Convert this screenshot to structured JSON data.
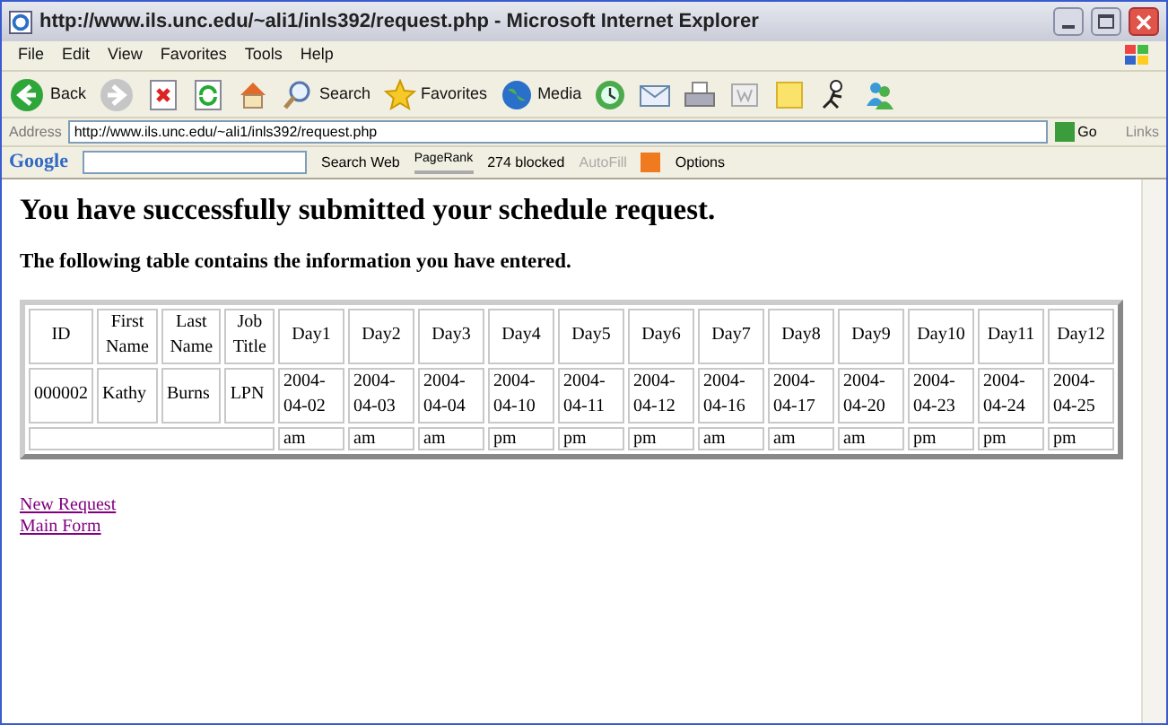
{
  "window": {
    "title": "http://www.ils.unc.edu/~ali1/inls392/request.php - Microsoft Internet Explorer"
  },
  "menu": [
    "File",
    "Edit",
    "View",
    "Favorites",
    "Tools",
    "Help"
  ],
  "toolbar": [
    {
      "kind": "back",
      "label": "Back"
    },
    {
      "kind": "forward"
    },
    {
      "kind": "stop"
    },
    {
      "kind": "refresh"
    },
    {
      "kind": "home"
    },
    {
      "kind": "search",
      "label": "Search"
    },
    {
      "kind": "favorites",
      "label": "Favorites"
    },
    {
      "kind": "media",
      "label": "Media"
    },
    {
      "kind": "history"
    },
    {
      "kind": "mail"
    },
    {
      "kind": "print"
    },
    {
      "kind": "edit"
    },
    {
      "kind": "note"
    },
    {
      "kind": "person"
    },
    {
      "kind": "messenger"
    }
  ],
  "address": {
    "label": "Address",
    "url": "http://www.ils.unc.edu/~ali1/inls392/request.php",
    "go": "Go",
    "links": "Links"
  },
  "google_bar": {
    "logo": "Google",
    "search_web": "Search Web",
    "pagerank": "PageRank",
    "blocked": "274 blocked",
    "autofill": {
      "label": "AutoFill",
      "disabled": true
    },
    "options": "Options"
  },
  "heading": "You have successfully submitted your schedule request.",
  "subheading": "The following table contains the information you have entered.",
  "table": {
    "columns": [
      "ID",
      "First Name",
      "Last Name",
      "Job Title",
      "Day1",
      "Day2",
      "Day3",
      "Day4",
      "Day5",
      "Day6",
      "Day7",
      "Day8",
      "Day9",
      "Day10",
      "Day11",
      "Day12"
    ],
    "row": [
      "000002",
      "Kathy",
      "Burns",
      "LPN",
      "2004-04-02",
      "2004-04-03",
      "2004-04-04",
      "2004-04-10",
      "2004-04-11",
      "2004-04-12",
      "2004-04-16",
      "2004-04-17",
      "2004-04-20",
      "2004-04-23",
      "2004-04-24",
      "2004-04-25"
    ],
    "times": [
      "am",
      "am",
      "am",
      "pm",
      "pm",
      "pm",
      "am",
      "am",
      "am",
      "pm",
      "pm",
      "pm"
    ]
  },
  "links": [
    "New Request",
    "Main Form"
  ]
}
